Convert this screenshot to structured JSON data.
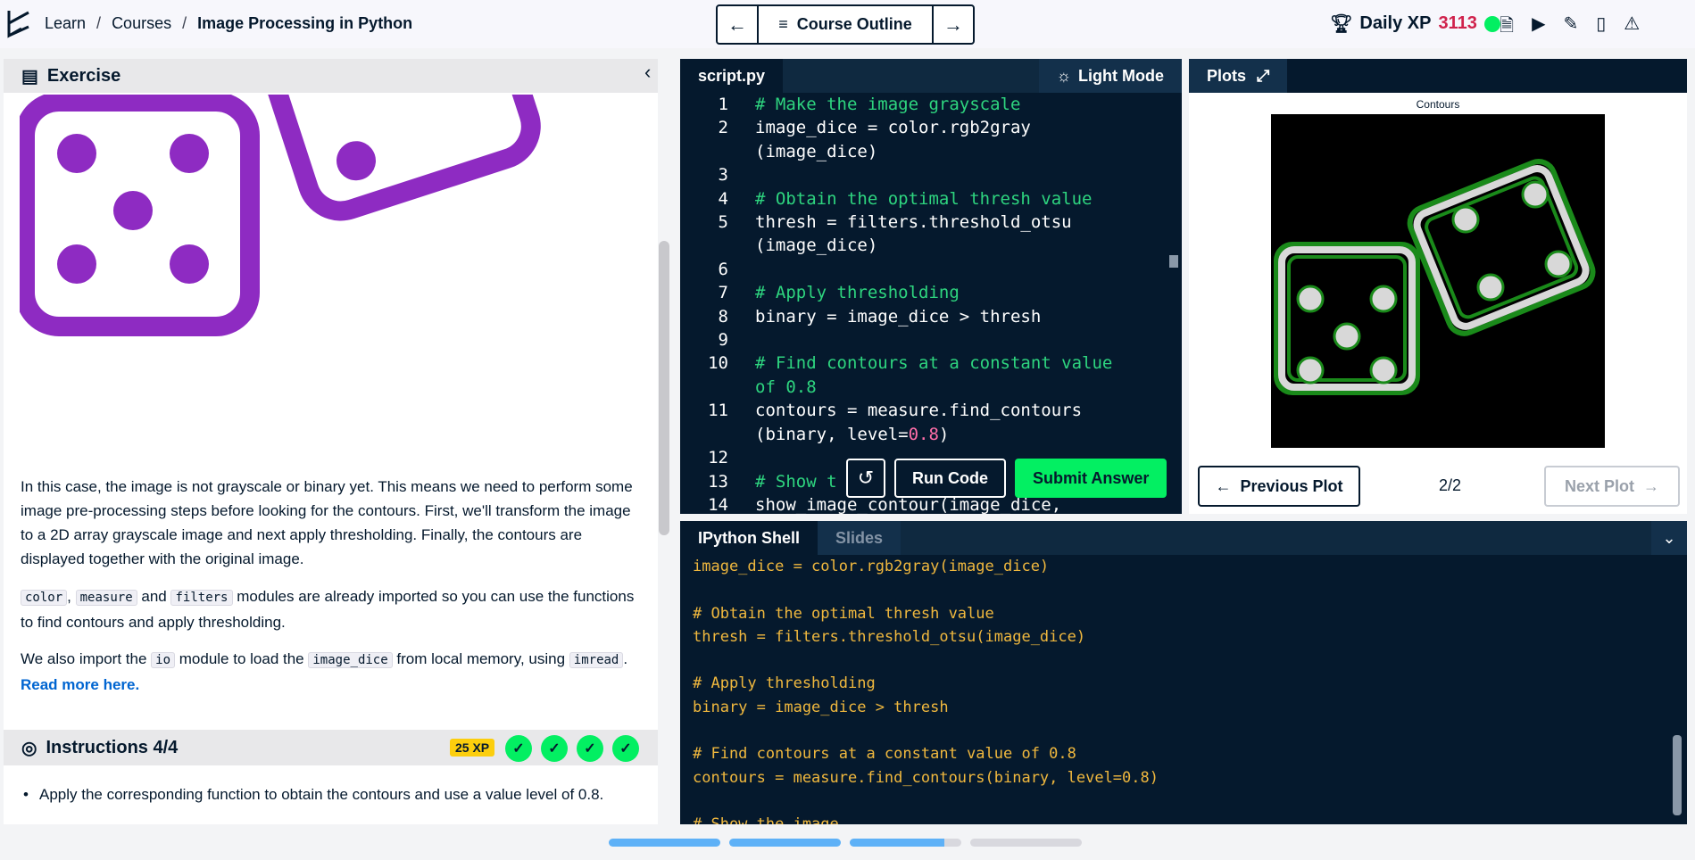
{
  "breadcrumb": {
    "items": [
      "Learn",
      "Courses",
      "Image Processing in Python"
    ],
    "separator": "/"
  },
  "nav": {
    "outline_label": "Course Outline"
  },
  "xp": {
    "label": "Daily XP",
    "value": "3113"
  },
  "exercise": {
    "title": "Exercise",
    "para1": "In this case, the image is not grayscale or binary yet. This means we need to perform some image pre-processing steps before looking for the contours. First, we'll transform the image to a 2D array grayscale image and next apply thresholding. Finally, the contours are displayed together with the original image.",
    "para2_codes": [
      "color",
      "measure",
      "filters"
    ],
    "para2_sep1": ",",
    "para2_sep2": "and",
    "para2_text": "modules are already imported so you can use the functions to find contours and apply thresholding.",
    "para3_a": "We also import the",
    "para3_code1": "io",
    "para3_b": "module to load the",
    "para3_code2": "image_dice",
    "para3_c": "from local memory, using",
    "para3_code3": "imread",
    "para3_dot": ".",
    "para3_link": "Read more here."
  },
  "instructions": {
    "title": "Instructions 4/4",
    "xp_badge": "25 XP",
    "bullet": "Apply the corresponding function to obtain the contours and use a value level of 0.8."
  },
  "editor": {
    "tab": "script.py",
    "light_mode": "Light Mode",
    "run_label": "Run Code",
    "submit_label": "Submit Answer",
    "lines": [
      {
        "n": "1",
        "text": "# Make the image grayscale",
        "comment": true
      },
      {
        "n": "2",
        "text": "image_dice = color.rgb2gray",
        "comment": false
      },
      {
        "n": "",
        "text": "(image_dice)",
        "comment": false
      },
      {
        "n": "3",
        "text": "",
        "comment": false
      },
      {
        "n": "4",
        "text": "# Obtain the optimal thresh value",
        "comment": true
      },
      {
        "n": "5",
        "text": "thresh = filters.threshold_otsu",
        "comment": false
      },
      {
        "n": "",
        "text": "(image_dice)",
        "comment": false
      },
      {
        "n": "6",
        "text": "",
        "comment": false
      },
      {
        "n": "7",
        "text": "# Apply thresholding",
        "comment": true
      },
      {
        "n": "8",
        "text": "binary = image_dice > thresh",
        "comment": false
      },
      {
        "n": "9",
        "text": "",
        "comment": false
      },
      {
        "n": "10",
        "text": "# Find contours at a constant value",
        "comment": true
      },
      {
        "n": "",
        "text": "of 0.8",
        "comment": true
      },
      {
        "n": "11",
        "text": "contours = measure.find_contours",
        "comment": false
      },
      {
        "n": "",
        "text": "(binary, level=",
        "comment": false,
        "num": "0.8",
        "tail": ")"
      },
      {
        "n": "12",
        "text": "",
        "comment": false
      },
      {
        "n": "13",
        "text": "# Show t",
        "comment": true
      },
      {
        "n": "14",
        "text": "show_image_contour(image_dice,",
        "comment": false
      }
    ]
  },
  "plots": {
    "tab": "Plots",
    "title": "Contours",
    "prev": "Previous Plot",
    "next": "Next Plot",
    "count": "2/2"
  },
  "shell": {
    "tab_active": "IPython Shell",
    "tab_inactive": "Slides",
    "lines": [
      "image_dice = color.rgb2gray(image_dice)",
      "",
      "# Obtain the optimal thresh value",
      "thresh = filters.threshold_otsu(image_dice)",
      "",
      "# Apply thresholding",
      "binary = image_dice > thresh",
      "",
      "# Find contours at a constant value of 0.8",
      "contours = measure.find_contours(binary, level=0.8)",
      "",
      "# Show the image"
    ]
  },
  "progress": {
    "segments": [
      1,
      1,
      0.85,
      0
    ]
  },
  "colors": {
    "accent_green": "#03ef62",
    "dice_purple": "#8e2bc2",
    "xp_red": "#d0224c",
    "comment_green": "#2ed57f",
    "shell_text": "#f0b83e"
  }
}
